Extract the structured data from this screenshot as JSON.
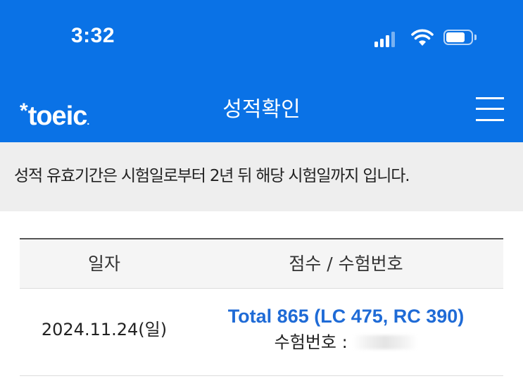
{
  "status_bar": {
    "time": "3:32",
    "icons": [
      "cellular-signal-icon",
      "wifi-icon",
      "battery-icon"
    ]
  },
  "header": {
    "logo_star": "*",
    "logo_text": "toeic",
    "logo_dot": ".",
    "title": "성적확인",
    "menu_icon": "hamburger-menu-icon",
    "background_color": "#0a72e6"
  },
  "notice": {
    "text": "성적 유효기간은 시험일로부터 2년 뒤 해당 시험일까지 입니다."
  },
  "table": {
    "headers": {
      "date": "일자",
      "score": "점수 / 수험번호"
    },
    "rows": [
      {
        "date": "2024.11.24(일)",
        "score": "Total 865 (LC 475, RC 390)",
        "exam_label": "수험번호 : "
      }
    ]
  },
  "colors": {
    "score_text": "#1f6bd6"
  }
}
